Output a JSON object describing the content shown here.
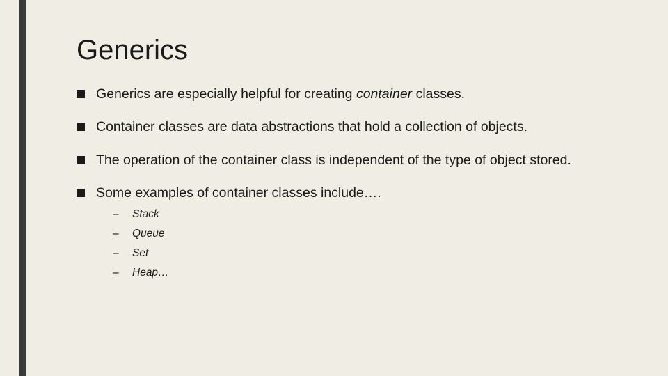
{
  "title": "Generics",
  "bullets": [
    {
      "pre": "Generics are especially helpful for creating ",
      "italic": "container",
      "post": " classes."
    },
    {
      "pre": "Container classes are data abstractions that hold a collection of objects.",
      "italic": "",
      "post": ""
    },
    {
      "pre": "The operation of the container class is independent of the type of object stored.",
      "italic": "",
      "post": ""
    },
    {
      "pre": "Some examples of container classes include….",
      "italic": "",
      "post": ""
    }
  ],
  "sublist": [
    "Stack",
    "Queue",
    "Set",
    "Heap…"
  ]
}
